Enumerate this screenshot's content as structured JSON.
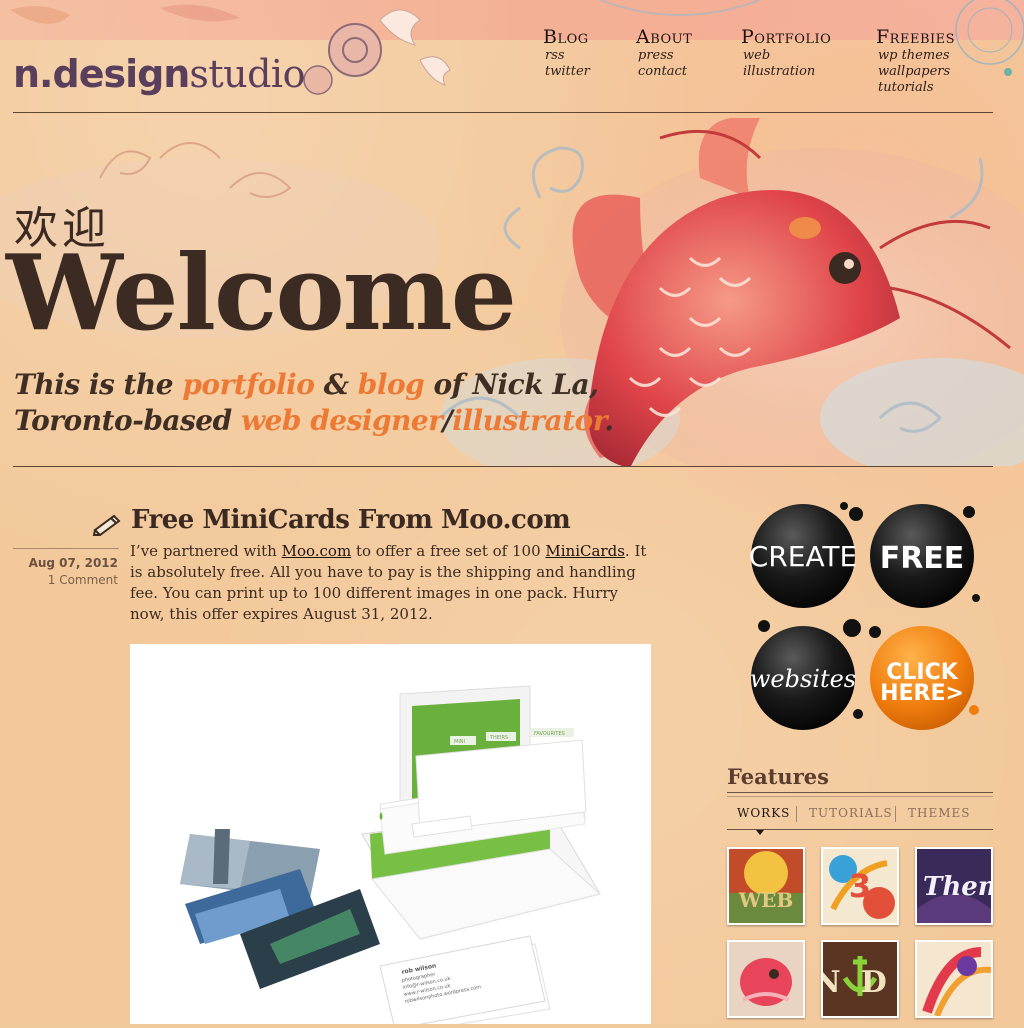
{
  "logo": {
    "bold": "n.design",
    "light": "studio"
  },
  "nav": [
    {
      "label": "Blog",
      "subs": [
        "rss",
        "twitter"
      ]
    },
    {
      "label": "About",
      "subs": [
        "press",
        "contact"
      ]
    },
    {
      "label": "Portfolio",
      "subs": [
        "web",
        "illustration"
      ]
    },
    {
      "label": "Freebies",
      "subs": [
        "wp themes",
        "wallpapers",
        "tutorials"
      ]
    }
  ],
  "banner": {
    "welcome_cn": "欢迎",
    "welcome_en": "Welcome",
    "tagline1": {
      "a": "This is the ",
      "b": "portfolio",
      "c": " & ",
      "d": "blog",
      "e": " of Nick La,"
    },
    "tagline2": {
      "a": "Toronto-based ",
      "b": "web designer",
      "c": "/",
      "d": "illustrator",
      "e": "."
    }
  },
  "post": {
    "title": "Free MiniCards From Moo.com",
    "date": "Aug 07, 2012",
    "comments": "1 Comment",
    "body": {
      "t1": "I’ve partnered with ",
      "link1": "Moo.com",
      "t2": " to offer a free set of 100 ",
      "link2": "MiniCards",
      "t3": ". It is absolutely free. All you have to pay is the shipping and handling fee. You can print up to 100 different images in one pack. Hurry now, this offer expires August 31, 2012."
    },
    "image_text": {
      "name": "rob wilson",
      "line1": "photographer",
      "line2": "info@r-wilson.co.uk",
      "line3": "www.r-wilson.co.uk",
      "line4": "robwilsonphoto.wordpress.com",
      "tab1": "MINI",
      "tab2": "THEIRS",
      "tab3": "FAVOURITES"
    }
  },
  "ad": {
    "create": "CREATE",
    "free": "FREE",
    "websites": "websites",
    "click1": "CLICK",
    "click2": "HERE>"
  },
  "features": {
    "title": "Features",
    "tabs": [
      "WORKS",
      "TUTORIALS",
      "THEMES"
    ],
    "active_tab": "WORKS",
    "thumbs": [
      "WEB",
      "3",
      "Them",
      "",
      "ND",
      ""
    ]
  },
  "colors": {
    "accent": "#ec7a34",
    "ink": "#3b2a22",
    "paper": "#f3c99b"
  }
}
